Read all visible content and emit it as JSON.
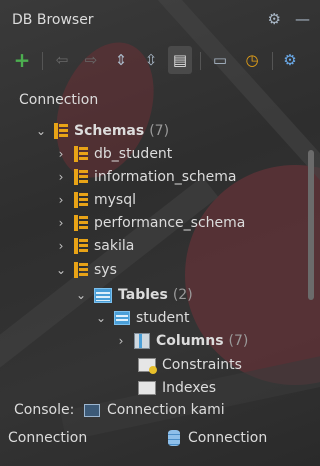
{
  "window": {
    "title": "DB Browser"
  },
  "titlebar_icons": [
    "gear-icon",
    "minimize-icon"
  ],
  "toolbar": {
    "buttons": [
      {
        "name": "add",
        "glyph": "+",
        "color": "#4caf50"
      },
      {
        "name": "back",
        "glyph": "⇦",
        "color": "#6a6a6a"
      },
      {
        "name": "forward",
        "glyph": "⇨",
        "color": "#6a6a6a"
      },
      {
        "name": "expand-all",
        "glyph": "⇕",
        "color": "#a9b7c6"
      },
      {
        "name": "collapse-all",
        "glyph": "⇳",
        "color": "#a9b7c6"
      },
      {
        "name": "view-options",
        "glyph": "▤",
        "color": "#d6d6d6"
      },
      {
        "name": "open-sql",
        "glyph": "🗔",
        "color": "#a9b7c6"
      },
      {
        "name": "history",
        "glyph": "⏲",
        "color": "#e8a317"
      },
      {
        "name": "settings",
        "glyph": "⚙",
        "color": "#6aa9e8"
      }
    ]
  },
  "section_label": "Connection",
  "tree": {
    "schemas": {
      "label": "Schemas",
      "count": "(7)"
    },
    "schema_items": [
      {
        "label": "db_student"
      },
      {
        "label": "information_schema"
      },
      {
        "label": "mysql"
      },
      {
        "label": "performance_schema"
      },
      {
        "label": "sakila"
      },
      {
        "label": "sys"
      }
    ],
    "tables": {
      "label": "Tables",
      "count": "(2)"
    },
    "student": {
      "label": "student"
    },
    "columns": {
      "label": "Columns",
      "count": "(7)"
    },
    "constraints": {
      "label": "Constraints"
    },
    "indexes": {
      "label": "Indexes"
    }
  },
  "footer": {
    "console_label": "Console:",
    "console_value": "Connection kami",
    "connection_label": "Connection",
    "connection_value": "Connection"
  },
  "colors": {
    "accent_orange": "#e8a317",
    "accent_blue": "#4a9fd8",
    "add_green": "#4caf50"
  }
}
